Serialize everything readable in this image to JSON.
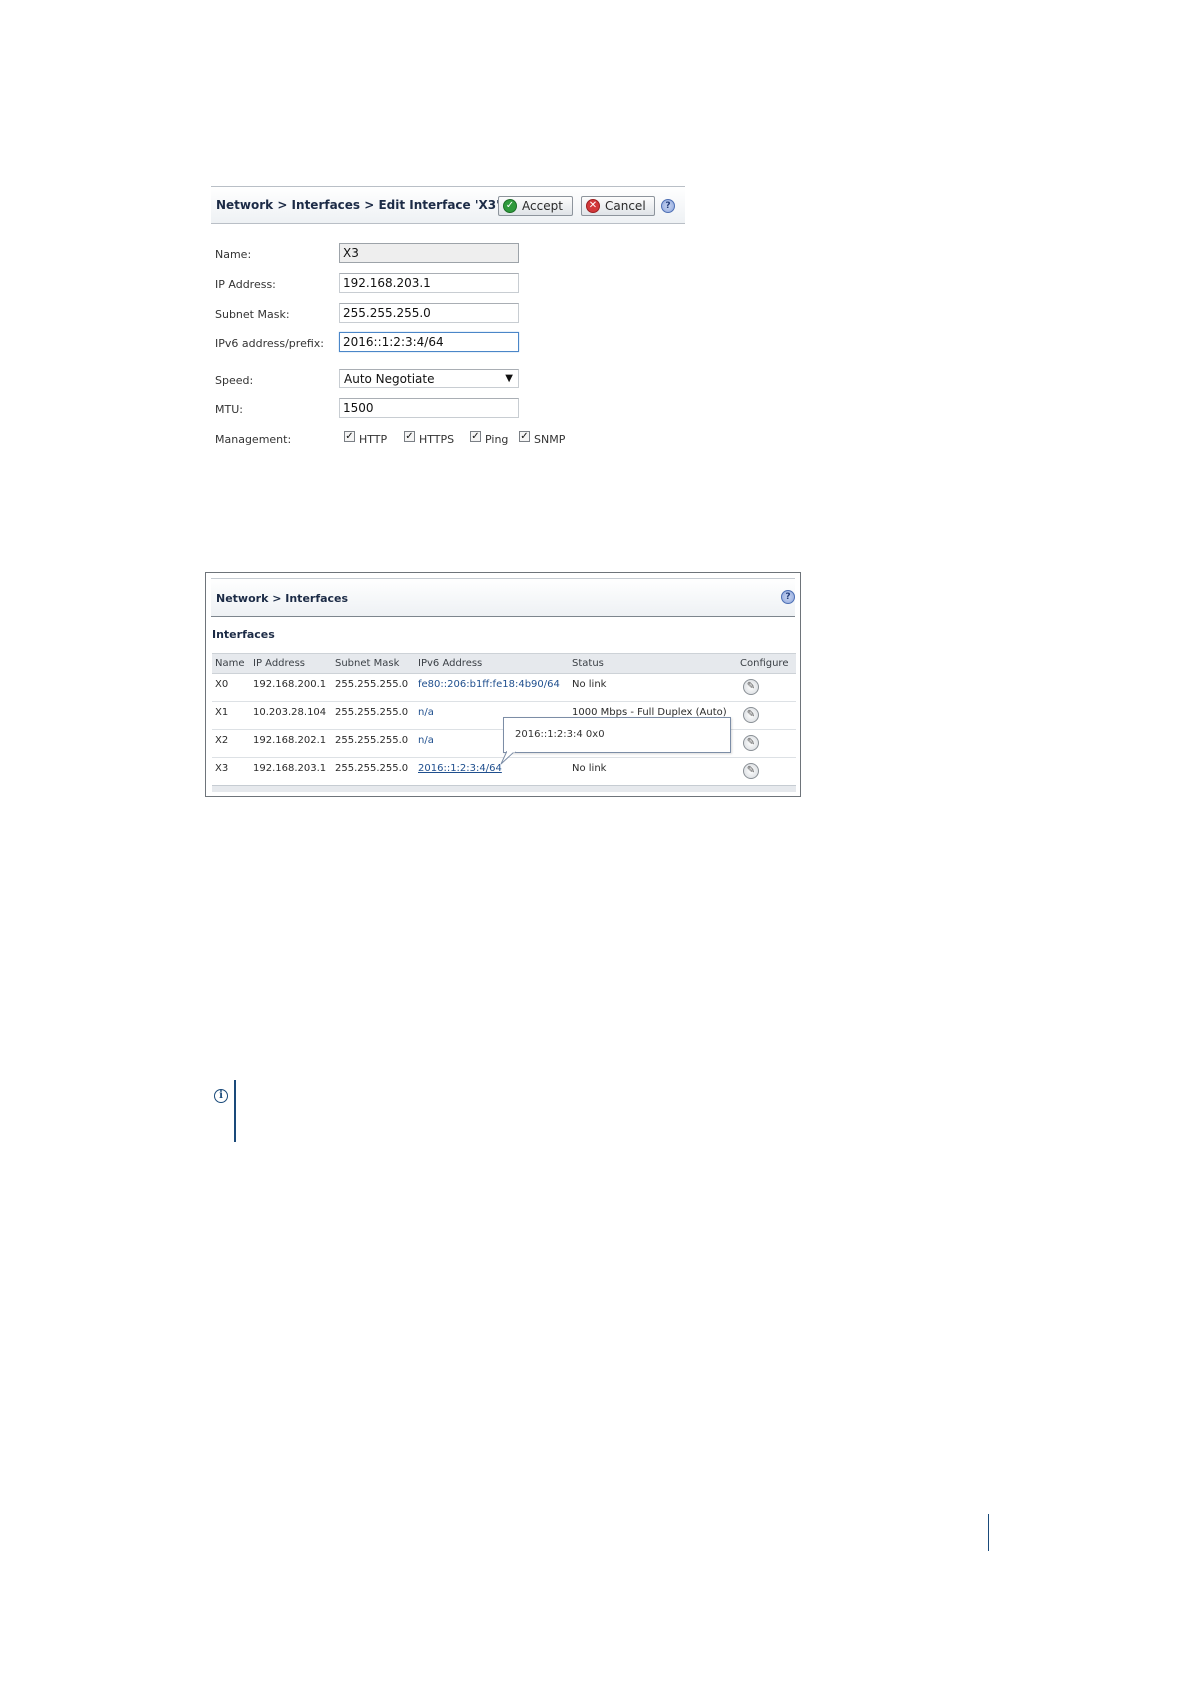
{
  "edit_panel": {
    "breadcrumb": "Network > Interfaces > Edit Interface 'X3'",
    "accept_label": "Accept",
    "cancel_label": "Cancel",
    "fields": {
      "name": {
        "label": "Name:",
        "value": "X3"
      },
      "ip_address": {
        "label": "IP Address:",
        "value": "192.168.203.1"
      },
      "subnet_mask": {
        "label": "Subnet Mask:",
        "value": "255.255.255.0"
      },
      "ipv6": {
        "label": "IPv6 address/prefix:",
        "value": "2016::1:2:3:4/64"
      },
      "speed": {
        "label": "Speed:",
        "value": "Auto Negotiate"
      },
      "mtu": {
        "label": "MTU:",
        "value": "1500"
      }
    },
    "management": {
      "label": "Management:",
      "options": [
        {
          "label": "HTTP",
          "checked": true
        },
        {
          "label": "HTTPS",
          "checked": true
        },
        {
          "label": "Ping",
          "checked": true
        },
        {
          "label": "SNMP",
          "checked": true
        }
      ]
    }
  },
  "interfaces_panel": {
    "breadcrumb": "Network > Interfaces",
    "section_title": "Interfaces",
    "columns": [
      "Name",
      "IP Address",
      "Subnet Mask",
      "IPv6 Address",
      "Status",
      "Configure"
    ],
    "rows": [
      {
        "name": "X0",
        "ip": "192.168.200.1",
        "mask": "255.255.255.0",
        "ipv6": "fe80::206:b1ff:fe18:4b90/64",
        "status": "No link"
      },
      {
        "name": "X1",
        "ip": "10.203.28.104",
        "mask": "255.255.255.0",
        "ipv6": "n/a",
        "status": "1000 Mbps - Full Duplex (Auto)"
      },
      {
        "name": "X2",
        "ip": "192.168.202.1",
        "mask": "255.255.255.0",
        "ipv6": "n/a",
        "status": ""
      },
      {
        "name": "X3",
        "ip": "192.168.203.1",
        "mask": "255.255.255.0",
        "ipv6": "2016::1:2:3:4/64",
        "status": "No link"
      }
    ],
    "tooltip": "2016::1:2:3:4 0x0"
  },
  "icons": {
    "accept": "check-circle-icon",
    "cancel": "x-circle-icon",
    "help": "help-icon",
    "configure": "pencil-icon",
    "note": "info-icon"
  },
  "colors": {
    "title_text": "#1c2b46",
    "link": "#1f4f8e",
    "accent_bar": "#1a4a7a",
    "accept_green": "#2f9a3c",
    "cancel_red": "#d2383a"
  }
}
